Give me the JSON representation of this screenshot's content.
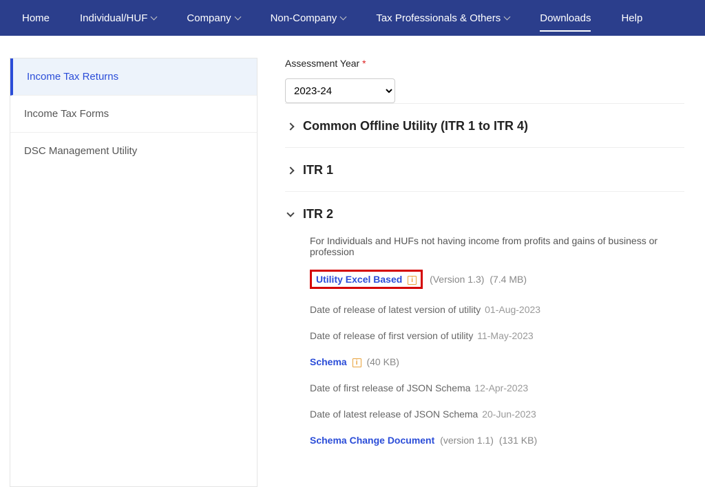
{
  "nav": {
    "home": "Home",
    "individual": "Individual/HUF",
    "company": "Company",
    "noncompany": "Non-Company",
    "taxpro": "Tax Professionals & Others",
    "downloads": "Downloads",
    "help": "Help"
  },
  "sidebar": {
    "items": [
      "Income Tax Returns",
      "Income Tax Forms",
      "DSC Management Utility"
    ]
  },
  "main": {
    "assessmentLabel": "Assessment Year",
    "assessmentValue": "2023-24",
    "sections": {
      "common": "Common Offline Utility (ITR 1 to ITR 4)",
      "itr1": "ITR 1",
      "itr2": {
        "title": "ITR 2",
        "desc": "For Individuals and HUFs not having income from profits and gains of business or profession",
        "utilityLink": "Utility Excel Based",
        "utilityVersion": "(Version 1.3)",
        "utilitySize": "(7.4 MB)",
        "dateLatestLabel": "Date of release of latest version of utility",
        "dateLatestVal": "01-Aug-2023",
        "dateFirstLabel": "Date of release of first version of utility",
        "dateFirstVal": "11-May-2023",
        "schemaLink": "Schema",
        "schemaSize": "(40 KB)",
        "jsonFirstLabel": "Date of first release of JSON Schema",
        "jsonFirstVal": "12-Apr-2023",
        "jsonLatestLabel": "Date of latest release of JSON Schema",
        "jsonLatestVal": "20-Jun-2023",
        "schemaChangeLink": "Schema Change Document",
        "schemaChangeVersion": "(version 1.1)",
        "schemaChangeSize": "(131 KB)"
      }
    }
  }
}
